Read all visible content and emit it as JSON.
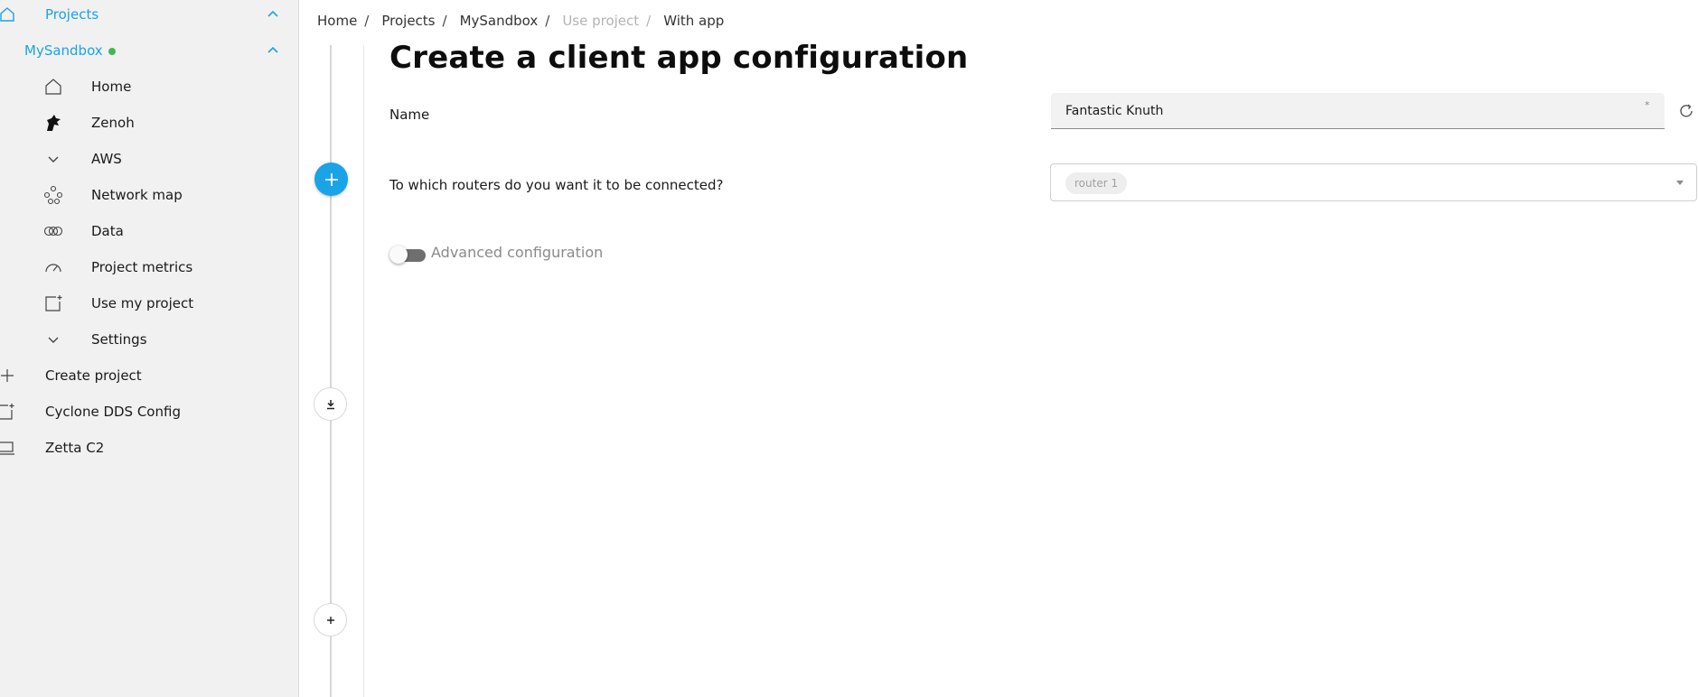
{
  "sidebar": {
    "projects_label": "Projects",
    "sandbox_label": "MySandbox",
    "items": [
      {
        "label": "Home",
        "icon": "home-icon"
      },
      {
        "label": "Zenoh",
        "icon": "zenoh-dragon-icon"
      },
      {
        "label": "AWS",
        "icon": "chevron-down-icon"
      },
      {
        "label": "Network map",
        "icon": "network-map-icon"
      },
      {
        "label": "Data",
        "icon": "data-rings-icon"
      },
      {
        "label": "Project metrics",
        "icon": "gauge-icon"
      },
      {
        "label": "Use my project",
        "icon": "add-box-icon"
      },
      {
        "label": "Settings",
        "icon": "chevron-down-icon"
      }
    ],
    "bottom_items": [
      {
        "label": "Create project",
        "icon": "plus-icon"
      },
      {
        "label": "Cyclone DDS Config",
        "icon": "add-box-icon"
      },
      {
        "label": "Zetta C2",
        "icon": "laptop-icon"
      }
    ],
    "accent_color": "#1aa3e6",
    "status_color": "#3fb950"
  },
  "breadcrumb": {
    "items": [
      "Home",
      "Projects",
      "MySandbox",
      "Use project",
      "With app"
    ]
  },
  "main": {
    "title": "Create a client app configuration",
    "name_label": "Name",
    "name_value": "Fantastic Knuth",
    "name_required_mark": "*",
    "routers_label": "To which routers do you want it to be connected?",
    "router_chip": "router 1",
    "advanced_label": "Advanced configuration",
    "advanced_enabled": false
  }
}
